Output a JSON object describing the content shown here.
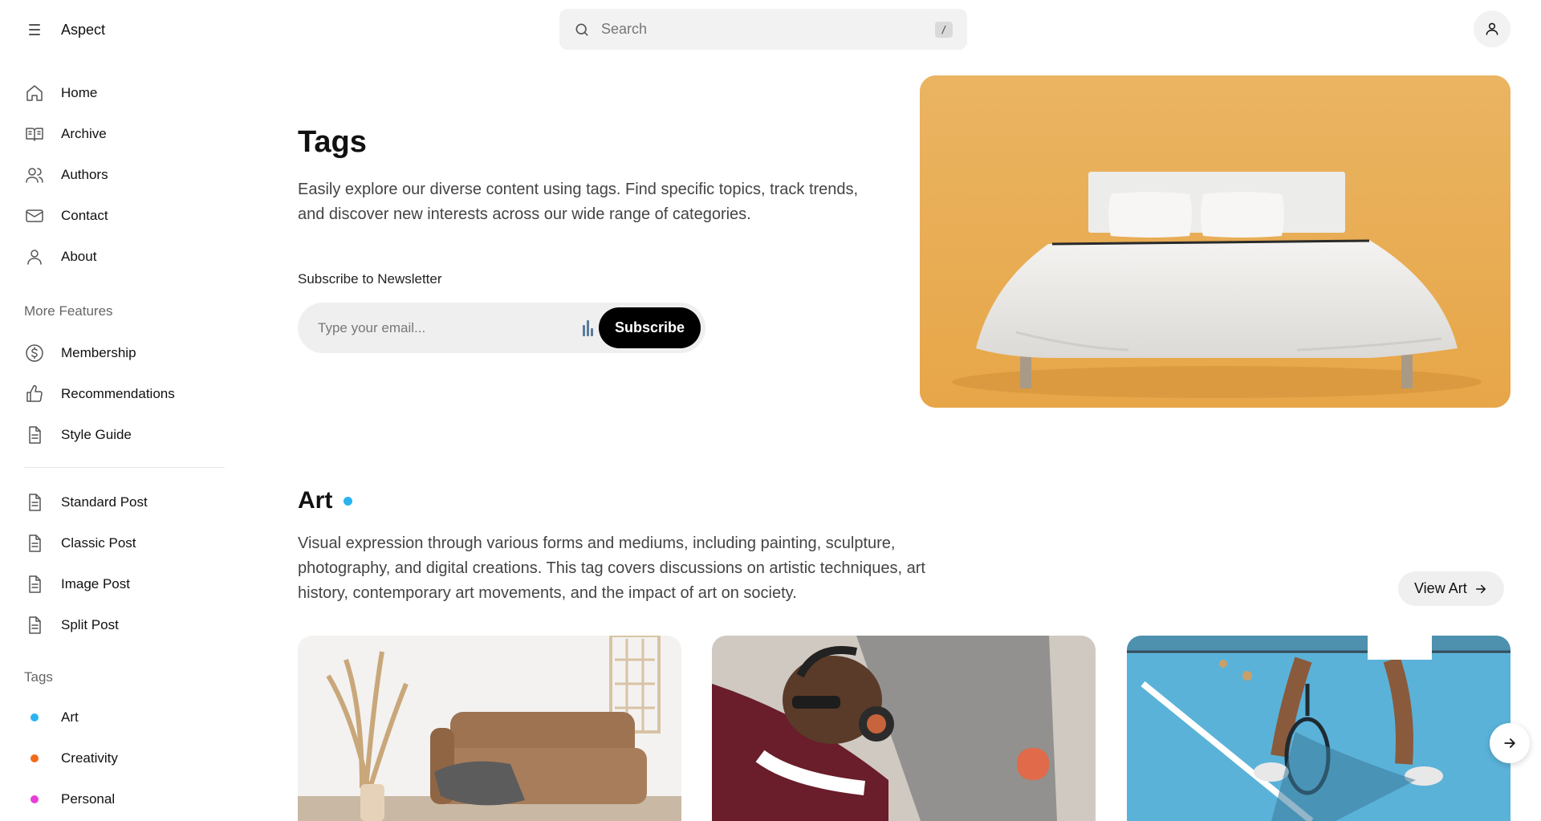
{
  "app": {
    "name": "Aspect"
  },
  "search": {
    "placeholder": "Search",
    "shortcut": "/"
  },
  "sidebar": {
    "main_nav": [
      {
        "label": "Home",
        "icon": "home-icon"
      },
      {
        "label": "Archive",
        "icon": "book-open-icon"
      },
      {
        "label": "Authors",
        "icon": "users-icon"
      },
      {
        "label": "Contact",
        "icon": "mail-icon"
      },
      {
        "label": "About",
        "icon": "user-icon"
      }
    ],
    "more_features_label": "More Features",
    "more_features": [
      {
        "label": "Membership",
        "icon": "dollar-circle-icon"
      },
      {
        "label": "Recommendations",
        "icon": "thumbs-up-icon"
      },
      {
        "label": "Style Guide",
        "icon": "document-icon"
      }
    ],
    "post_types": [
      {
        "label": "Standard Post",
        "icon": "document-icon"
      },
      {
        "label": "Classic Post",
        "icon": "document-icon"
      },
      {
        "label": "Image Post",
        "icon": "document-icon"
      },
      {
        "label": "Split Post",
        "icon": "document-icon"
      }
    ],
    "tags_label": "Tags",
    "tags": [
      {
        "label": "Art",
        "color": "#2bb3f0"
      },
      {
        "label": "Creativity",
        "color": "#f26b1d"
      },
      {
        "label": "Personal",
        "color": "#e83ed8"
      }
    ]
  },
  "hero": {
    "title": "Tags",
    "description": "Easily explore our diverse content using tags. Find specific topics, track trends, and discover new interests across our wide range of categories.",
    "newsletter_label": "Subscribe to Newsletter",
    "email_placeholder": "Type your email...",
    "subscribe_label": "Subscribe"
  },
  "art_section": {
    "title": "Art",
    "color": "#2bb3f0",
    "description": "Visual expression through various forms and mediums, including painting, sculpture, photography, and digital creations. This tag covers discussions on artistic techniques, art history, contemporary art movements, and the impact of art on society.",
    "view_label": "View Art"
  },
  "colors": {
    "hero_bg": "#e9b15a",
    "accent_dark": "#000000"
  }
}
